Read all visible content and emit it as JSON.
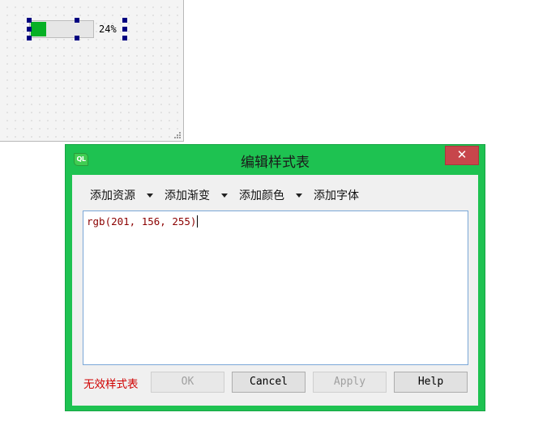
{
  "form": {
    "progress": {
      "value": 24,
      "label": "24%"
    }
  },
  "dialog": {
    "icon_text": "QL",
    "title": "编辑样式表",
    "close_label": "✕",
    "toolbar": [
      {
        "label": "添加资源",
        "has_menu": true
      },
      {
        "label": "添加渐变",
        "has_menu": true
      },
      {
        "label": "添加颜色",
        "has_menu": true
      },
      {
        "label": "添加字体",
        "has_menu": false
      }
    ],
    "editor_text": "rgb(201, 156, 255)",
    "status": "无效样式表",
    "buttons": {
      "ok": "OK",
      "cancel": "Cancel",
      "apply": "Apply",
      "help": "Help"
    }
  },
  "colors": {
    "progress_chunk": "#06b025",
    "dialog_frame": "#1ec251",
    "close_button": "#c7464b",
    "error_text": "#d00000"
  }
}
